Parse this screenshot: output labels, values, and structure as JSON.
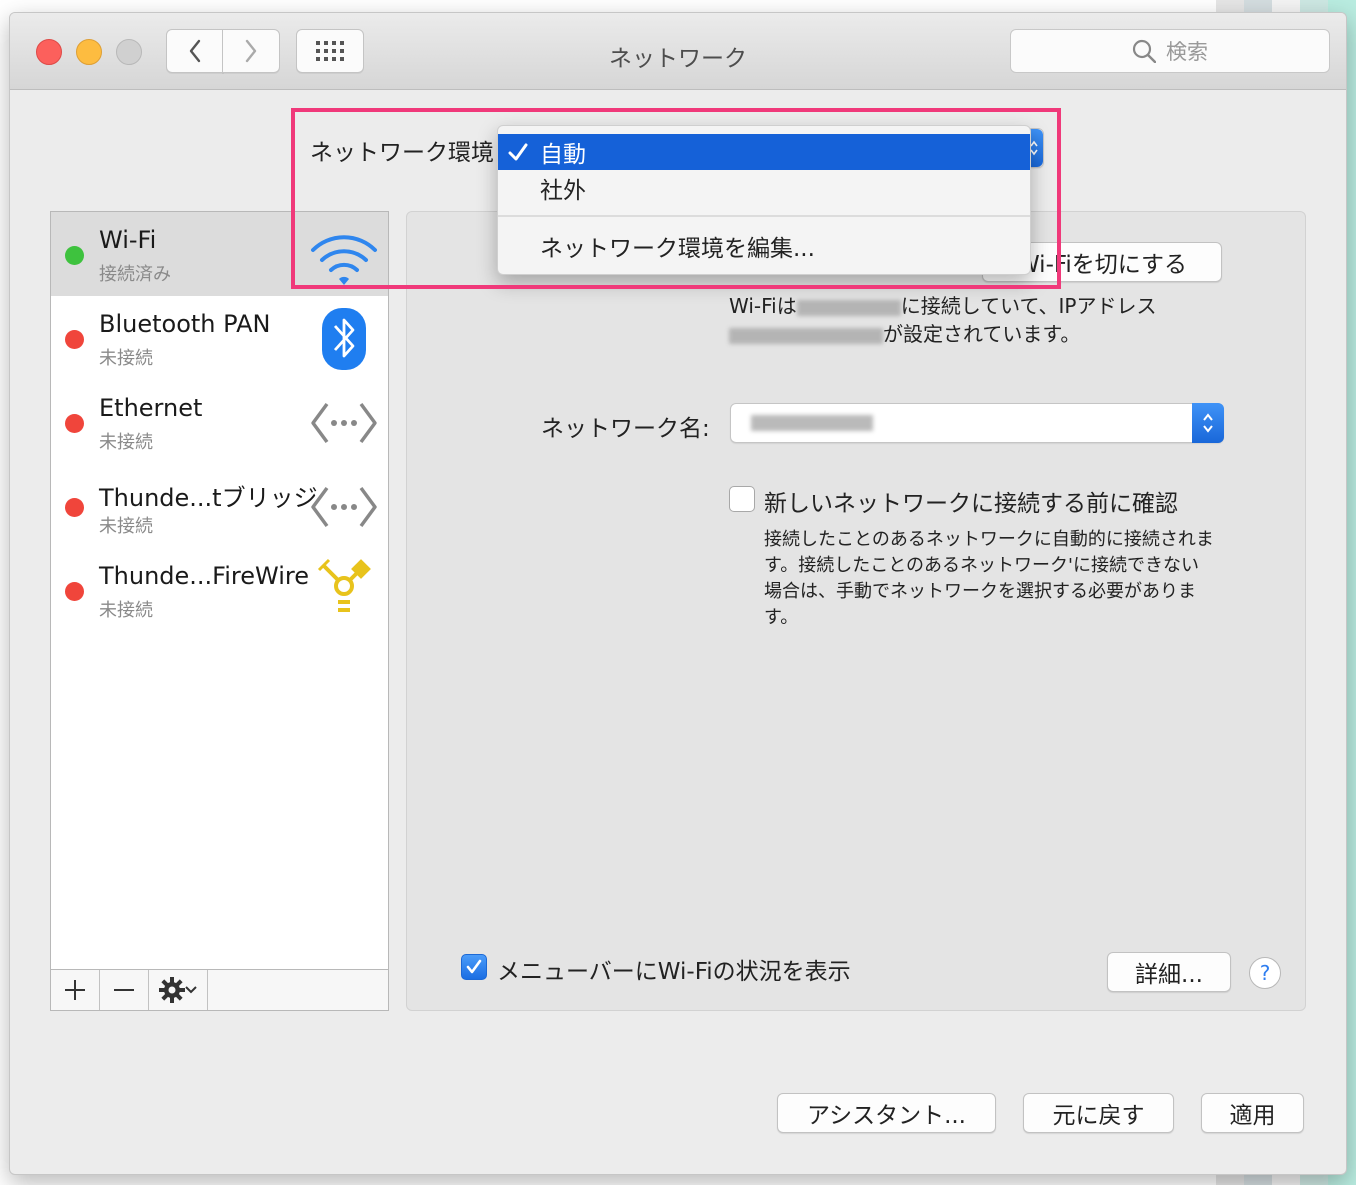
{
  "window": {
    "title": "ネットワーク"
  },
  "search": {
    "label": "検索"
  },
  "location": {
    "label": "ネットワーク環境",
    "menu": {
      "items": [
        "自動",
        "社外"
      ],
      "selected": "自動",
      "edit": "ネットワーク環境を編集..."
    }
  },
  "services": [
    {
      "name": "Wi-Fi",
      "status": "接続済み",
      "icon": "wifi-icon",
      "dot": "#3ec23e"
    },
    {
      "name": "Bluetooth PAN",
      "status": "未接続",
      "icon": "bluetooth-icon",
      "dot": "#f0453b"
    },
    {
      "name": "Ethernet",
      "status": "未接続",
      "icon": "ethernet-icon",
      "dot": "#f0453b"
    },
    {
      "name": "Thunde...tブリッジ",
      "status": "未接続",
      "icon": "ethernet-icon",
      "dot": "#f0453b"
    },
    {
      "name": "Thunde...FireWire",
      "status": "未接続",
      "icon": "firewire-icon",
      "dot": "#f0453b"
    }
  ],
  "sidebar_toolbar": {
    "add": "+",
    "remove": "—"
  },
  "wifi": {
    "toggle_button": "Wi-Fiを切にする",
    "status_line1_prefix": "Wi-Fiは",
    "status_line1_suffix": "に接続していて、IPアドレス",
    "status_line2_suffix": "が設定されています。",
    "network_name_label": "ネットワーク名:",
    "ask_to_join_label": "新しいネットワークに接続する前に確認",
    "ask_to_join_checked": false,
    "ask_to_join_help": "接続したことのあるネットワークに自動的に接続されます。接続したことのあるネットワーク'に接続できない場合は、手動でネットワークを選択する必要があります。",
    "show_in_menubar_label": "メニューバーにWi-Fiの状況を表示",
    "show_in_menubar_checked": true,
    "advanced_button": "詳細...",
    "help": "?"
  },
  "footer": {
    "assistant": "アシスタント...",
    "revert": "元に戻す",
    "apply": "適用"
  },
  "colors": {
    "accent": "#1561d8",
    "highlight": "#f0397a"
  }
}
